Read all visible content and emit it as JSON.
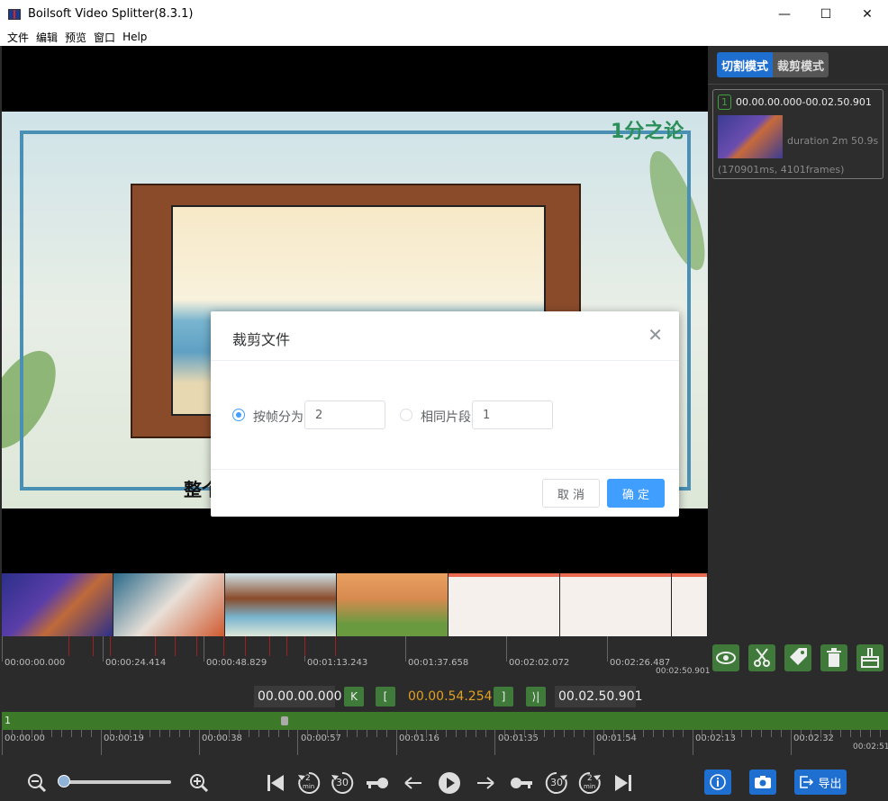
{
  "window": {
    "title": "Boilsoft Video Splitter(8.3.1)",
    "minimize": "—",
    "maximize": "☐",
    "close": "✕"
  },
  "menu": [
    "文件",
    "编辑",
    "预览",
    "窗口",
    "Help"
  ],
  "video": {
    "subtitle": "整个",
    "logo": "1分之论"
  },
  "mode_tabs": {
    "split": "切割模式",
    "trim": "裁剪模式"
  },
  "clip": {
    "index": "1",
    "range": "00.00.00.000-00.02.50.901",
    "duration": "duration 2m 50.9s",
    "frames": "(170901ms, 4101frames)"
  },
  "ruler_top": {
    "labels": [
      "00:00:00.000",
      "00:00:24.414",
      "00:00:48.829",
      "00:01:13.243",
      "00:01:37.658",
      "00:02:02.072",
      "00:02:26.487"
    ],
    "end_label": "00:02:50.901"
  },
  "timebar": {
    "start": "00.00.00.000",
    "current": "00.00.54.254",
    "end": "00.02.50.901",
    "btn_prev": "K",
    "btn_mark_in": "[",
    "btn_mark_out": "]",
    "btn_next": "⟩|"
  },
  "track": {
    "label": "1"
  },
  "ruler_bottom": {
    "labels": [
      "00:00:00",
      "00:00:19",
      "00:00:38",
      "00:00:57",
      "00:01:16",
      "00:01:35",
      "00:01:54",
      "00:02:13",
      "00:02:32"
    ],
    "end_label": "00:02:51"
  },
  "controls": {
    "skip_2min_label": "2",
    "skip_2min_unit": "min",
    "skip_30_label": "30",
    "export_label": "导出"
  },
  "dialog": {
    "title": "裁剪文件",
    "close": "✕",
    "option_frames_label": "按帧分为",
    "option_frames_value": "2",
    "option_same_label": "相同片段",
    "option_same_value": "1",
    "cancel": "取 消",
    "ok": "确 定"
  }
}
